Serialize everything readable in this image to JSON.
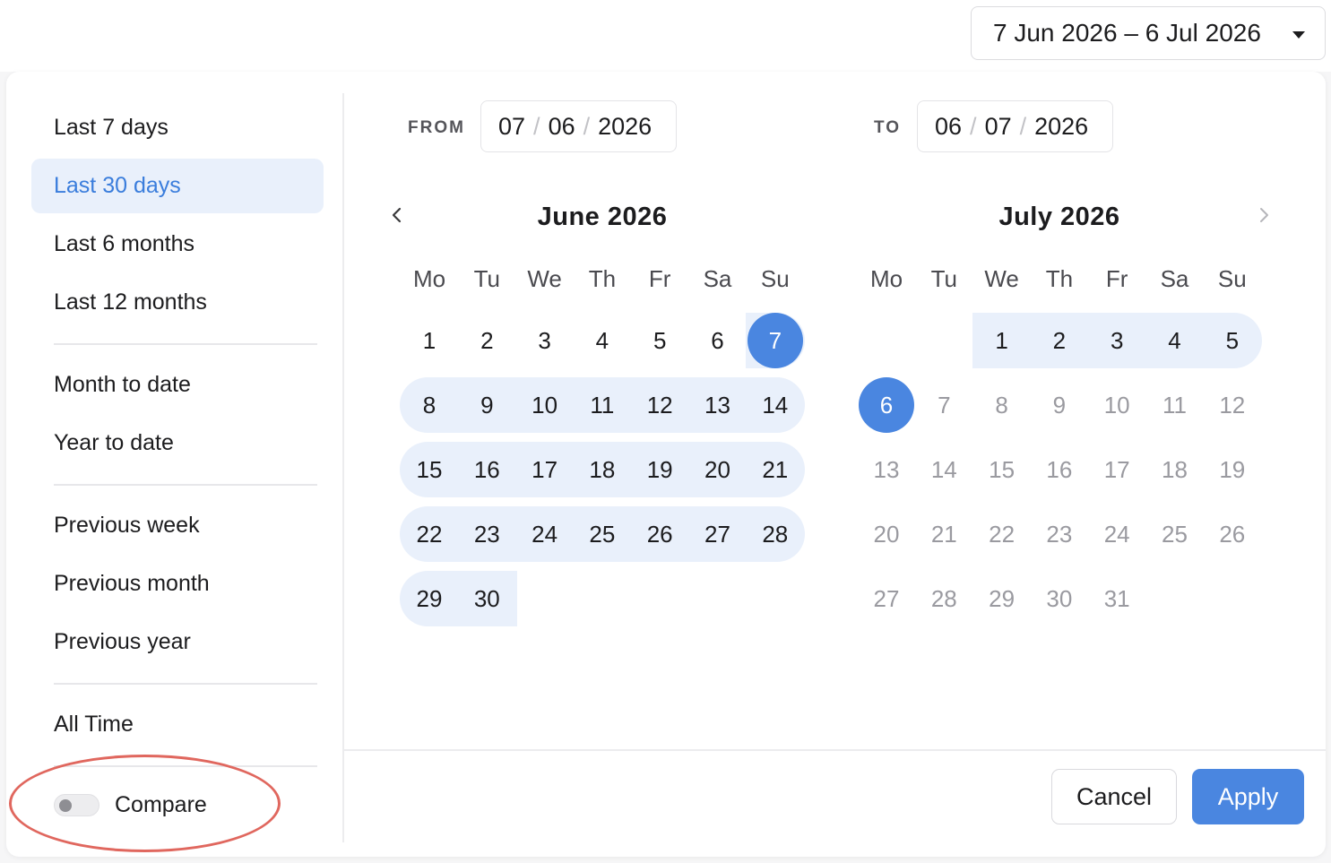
{
  "trigger": {
    "label": "7 Jun 2026 – 6 Jul 2026"
  },
  "presets": [
    {
      "label": "Last 7 days"
    },
    {
      "label": "Last 30 days"
    },
    {
      "label": "Last 6 months"
    },
    {
      "label": "Last 12 months"
    },
    {
      "label": "Month to date"
    },
    {
      "label": "Year to date"
    },
    {
      "label": "Previous week"
    },
    {
      "label": "Previous month"
    },
    {
      "label": "Previous year"
    },
    {
      "label": "All Time"
    }
  ],
  "active_preset": "Last 30 days",
  "compare": {
    "label": "Compare",
    "enabled": false
  },
  "from": {
    "label": "FROM",
    "day": "07",
    "month": "06",
    "year": "2026",
    "sep": "/"
  },
  "to": {
    "label": "TO",
    "day": "06",
    "month": "07",
    "year": "2026",
    "sep": "/"
  },
  "weekdays": [
    "Mo",
    "Tu",
    "We",
    "Th",
    "Fr",
    "Sa",
    "Su"
  ],
  "months": [
    {
      "title": "June 2026",
      "lead_blanks": 0,
      "days": 30,
      "sel_day": 7,
      "range_from": 7,
      "range_to": 30
    },
    {
      "title": "July 2026",
      "lead_blanks": 2,
      "days": 31,
      "sel_day": 6,
      "range_from": 1,
      "range_to": 5
    }
  ],
  "actions": {
    "cancel": "Cancel",
    "apply": "Apply"
  },
  "colors": {
    "accent": "#4a86e0",
    "range": "#e9f0fb",
    "annotation": "#e0675e"
  }
}
